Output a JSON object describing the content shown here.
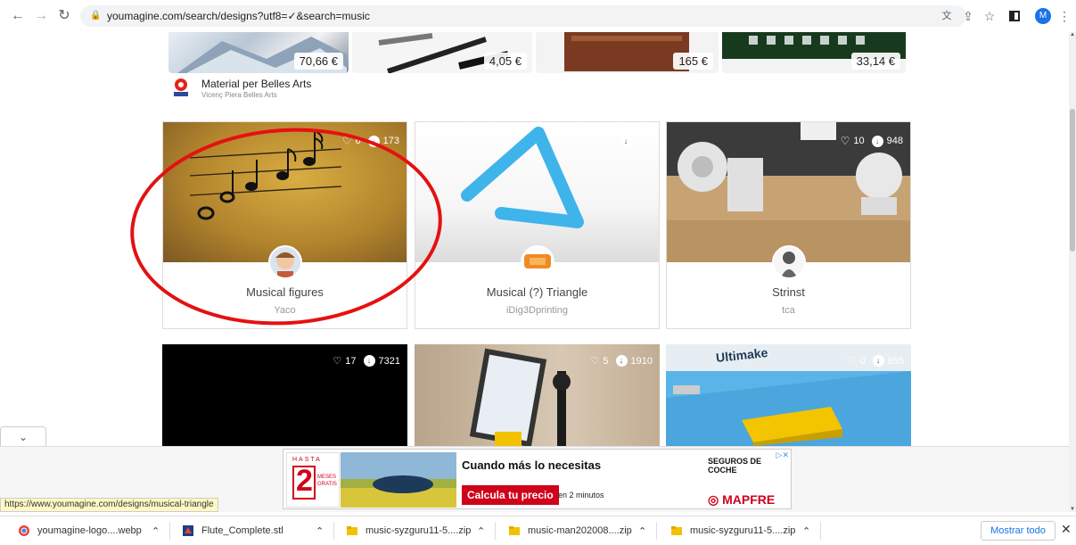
{
  "browser": {
    "url": "youmagine.com/search/designs?utf8=✓&search=music",
    "profile_initial": "M",
    "status_url": "https://www.youmagine.com/designs/musical-triangle"
  },
  "products": [
    {
      "price": "70,66 €"
    },
    {
      "price": "4,05 €"
    },
    {
      "price": "165 €"
    },
    {
      "price": "33,14 €"
    }
  ],
  "advertiser": {
    "name": "Material per Belles Arts",
    "sub": "Vicenç Piera Belles Arts"
  },
  "cards": [
    {
      "title": "Musical figures",
      "author": "Yaco",
      "likes": "6",
      "downloads": "173"
    },
    {
      "title": "Musical (?) Triangle",
      "author": "iDig3Dprinting",
      "likes": "0",
      "downloads": "247"
    },
    {
      "title": "Strinst",
      "author": "tca",
      "likes": "10",
      "downloads": "948"
    }
  ],
  "cards_row2": [
    {
      "likes": "17",
      "downloads": "7321"
    },
    {
      "likes": "5",
      "downloads": "1910"
    },
    {
      "likes": "0",
      "downloads": "955",
      "image_text": "Ultimake"
    }
  ],
  "ad": {
    "hasta": "HASTA",
    "num": "2",
    "meses": "MESES",
    "gratis": "GRATIS",
    "headline": "Cuando más lo necesitas",
    "brand_top": "SEGUROS DE COCHE",
    "cta": "Calcula tu precio",
    "cta_note": "en 2 minutos",
    "brand": "MAPFRE"
  },
  "downloads_bar": {
    "items": [
      {
        "name": "youmagine-logo....webp"
      },
      {
        "name": "Flute_Complete.stl"
      },
      {
        "name": "music-syzguru11-5....zip"
      },
      {
        "name": "music-man202008....zip"
      },
      {
        "name": "music-syzguru11-5....zip"
      }
    ],
    "show_all": "Mostrar todo"
  }
}
